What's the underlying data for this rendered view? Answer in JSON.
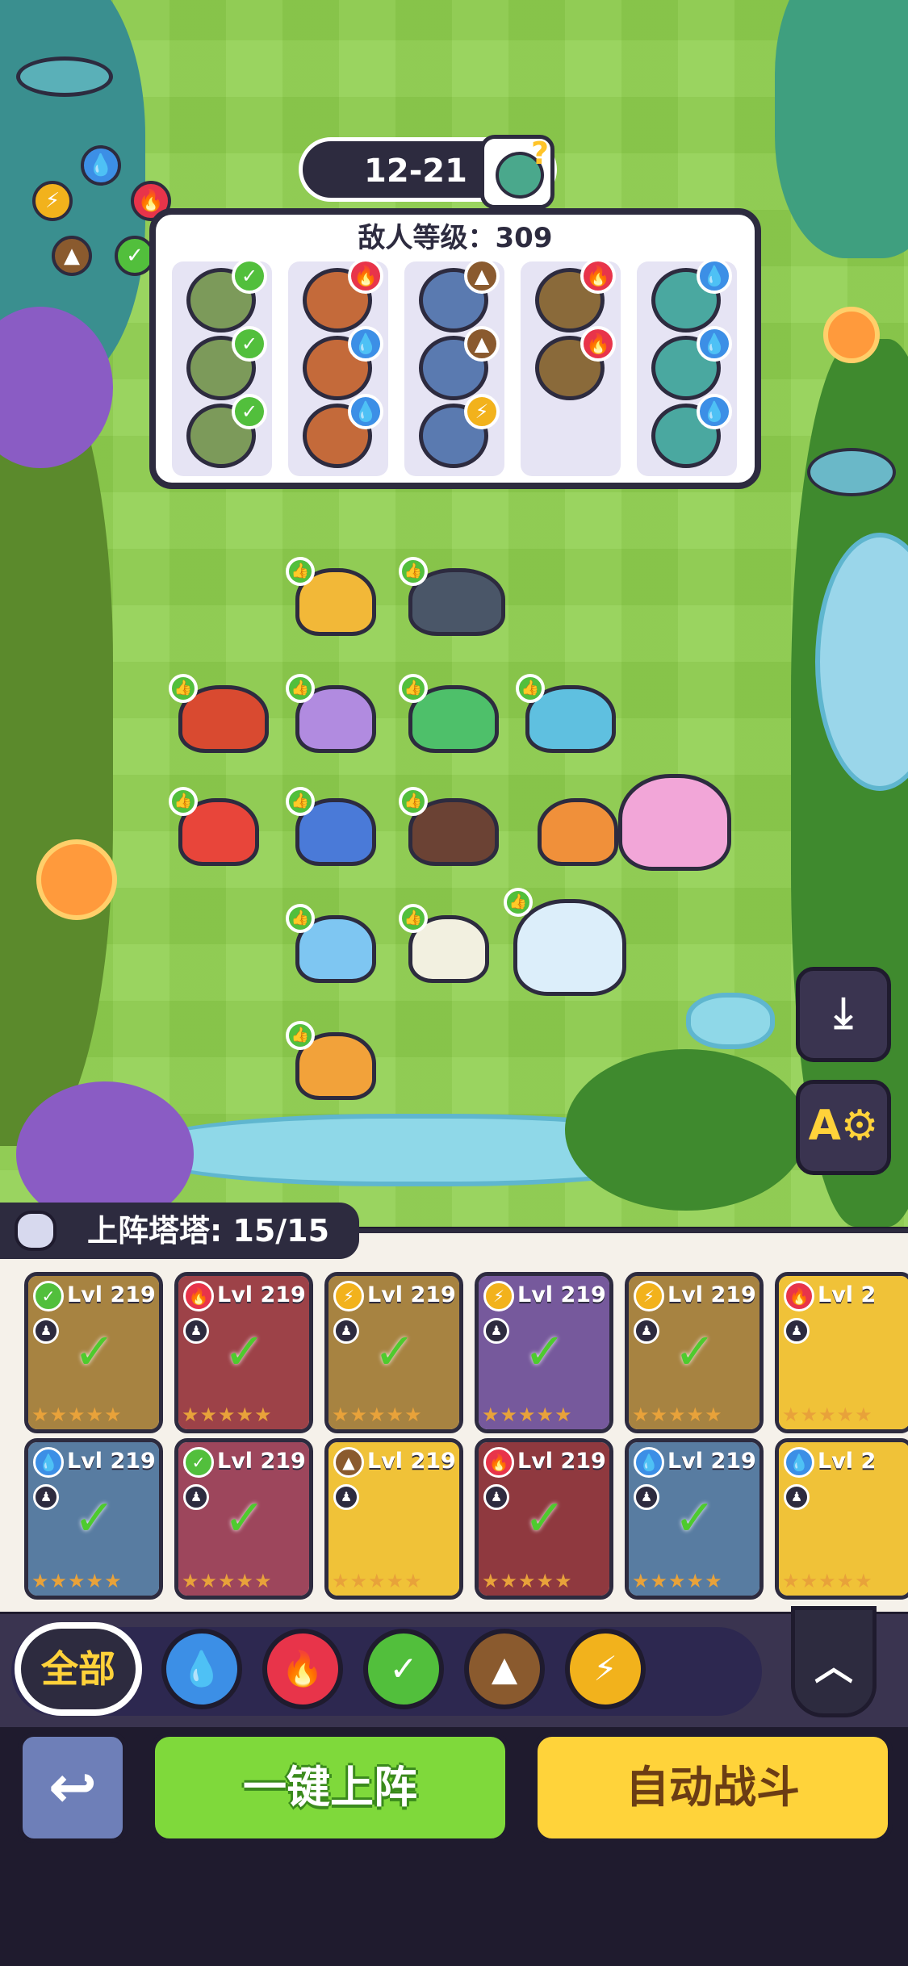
{
  "stage": {
    "label": "12-21"
  },
  "enemy_panel": {
    "title": "敌人等级：309",
    "columns": [
      {
        "elements": [
          "grass",
          "grass",
          "grass"
        ]
      },
      {
        "elements": [
          "fire",
          "water",
          "water"
        ]
      },
      {
        "elements": [
          "earth",
          "earth",
          "lightning"
        ]
      },
      {
        "elements": [
          "fire",
          "fire"
        ]
      },
      {
        "elements": [
          "water",
          "water",
          "water"
        ]
      }
    ]
  },
  "element_wheel": [
    "water",
    "fire",
    "grass",
    "earth",
    "lightning"
  ],
  "roster": {
    "label": "上阵塔塔: 15/15",
    "cards": [
      {
        "level": "Lvl 219",
        "element": "grass",
        "deployed": true,
        "color": "#e9b23e"
      },
      {
        "level": "Lvl 219",
        "element": "fire",
        "deployed": true,
        "color": "#d94a4a"
      },
      {
        "level": "Lvl 219",
        "element": "lightning",
        "deployed": true,
        "color": "#e9b23e"
      },
      {
        "level": "Lvl 219",
        "element": "lightning",
        "deployed": true,
        "color": "#9a6fd1"
      },
      {
        "level": "Lvl 219",
        "element": "lightning",
        "deployed": true,
        "color": "#e9b23e"
      },
      {
        "level": "Lvl 2",
        "element": "fire",
        "deployed": false,
        "color": "#f0c238"
      },
      {
        "level": "Lvl 219",
        "element": "water",
        "deployed": true,
        "color": "#6aa6d9"
      },
      {
        "level": "Lvl 219",
        "element": "grass",
        "deployed": true,
        "color": "#d9506a"
      },
      {
        "level": "Lvl 219",
        "element": "earth",
        "deployed": false,
        "color": "#f0c238"
      },
      {
        "level": "Lvl 219",
        "element": "fire",
        "deployed": true,
        "color": "#c23a3a"
      },
      {
        "level": "Lvl 219",
        "element": "water",
        "deployed": true,
        "color": "#6aa6d9"
      },
      {
        "level": "Lvl 2",
        "element": "water",
        "deployed": false,
        "color": "#f0c238"
      }
    ]
  },
  "filters": {
    "all_label": "全部",
    "elements": [
      "water",
      "fire",
      "grass",
      "earth",
      "lightning"
    ]
  },
  "actions": {
    "deploy_label": "一键上阵",
    "auto_label": "自动战斗"
  },
  "colors": {
    "water": "#3c8fe6",
    "fire": "#e8344a",
    "grass": "#52bf3c",
    "earth": "#8a5a2e",
    "lightning": "#f2b21c"
  }
}
